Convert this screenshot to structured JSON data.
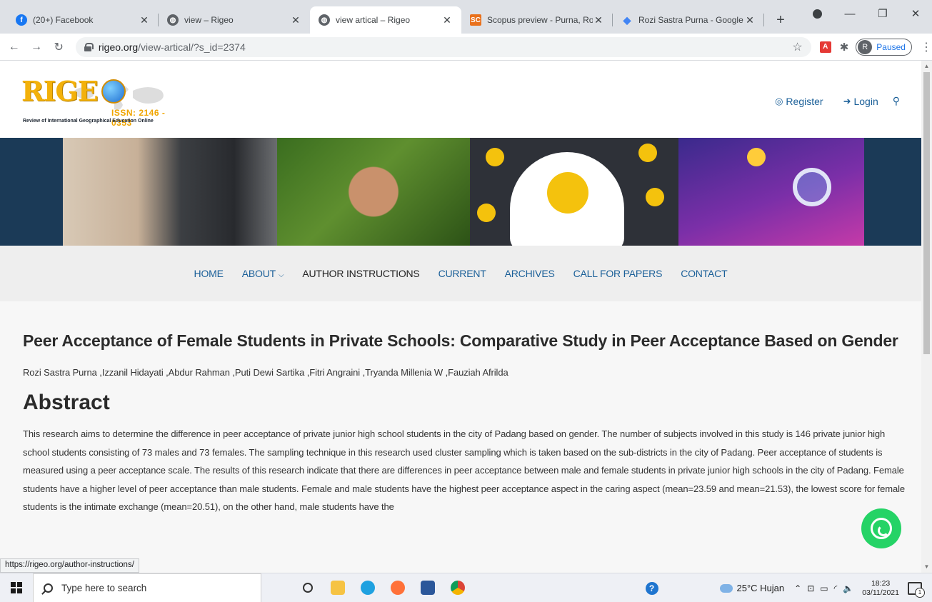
{
  "browser": {
    "tabs": [
      {
        "title": "(20+) Facebook",
        "icon": "facebook-icon",
        "color": "#1877f2"
      },
      {
        "title": "view – Rigeo",
        "icon": "globe-icon",
        "color": "#5f6368"
      },
      {
        "title": "view artical – Rigeo",
        "icon": "globe-icon",
        "color": "#5f6368",
        "active": true
      },
      {
        "title": "Scopus preview - Purna, Rozi",
        "icon": "scopus-icon",
        "color": "#e9711c",
        "icon_text": "SC"
      },
      {
        "title": "Rozi Sastra Purna - Google Scholar",
        "icon": "scholar-icon",
        "color": "#4285f4"
      }
    ],
    "new_tab": "+",
    "url_host": "rigeo.org",
    "url_path": "/view-artical/?s_id=2374",
    "profile_initial": "R",
    "profile_status": "Paused",
    "pdf_text": "A"
  },
  "site": {
    "logo_text": "RIGE",
    "issn": "ISSN: 2146 - 0353",
    "tagline": "Review of International Geographical Education Online",
    "register": "Register",
    "login": "Login",
    "accent": "#1a5f98",
    "nav": [
      {
        "label": "HOME",
        "style": "link"
      },
      {
        "label": "ABOUT",
        "style": "link",
        "dropdown": true
      },
      {
        "label": "AUTHOR INSTRUCTIONS",
        "style": "dark"
      },
      {
        "label": "CURRENT",
        "style": "link"
      },
      {
        "label": "ARCHIVES",
        "style": "link"
      },
      {
        "label": "CALL FOR PAPERS",
        "style": "link"
      },
      {
        "label": "CONTACT",
        "style": "link"
      }
    ]
  },
  "article": {
    "title": "Peer Acceptance of Female Students in Private Schools: Comparative Study in Peer Acceptance Based on Gender",
    "authors": "Rozi Sastra Purna ,Izzanil Hidayati ,Abdur Rahman ,Puti Dewi Sartika ,Fitri Angraini ,Tryanda Millenia W ,Fauziah Afrilda",
    "abstract_heading": "Abstract",
    "abstract": "This research aims to determine the difference in peer acceptance of private junior high school students in the city of Padang based on gender. The number of subjects involved in this study is 146 private junior high school students consisting of 73 males and 73 females. The sampling technique in this research used cluster sampling which is taken based on the sub-districts in the city of Padang. Peer acceptance of students is measured using a peer acceptance scale. The results of this research indicate that there are differences in peer acceptance between male and female students in private junior high schools in the city of Padang. Female students have a higher level of peer acceptance than male students. Female and male students have the highest peer acceptance aspect in the caring aspect (mean=23.59 and mean=21.53), the lowest score for female students is the intimate exchange (mean=20.51), on the other hand, male students have the"
  },
  "status_url": "https://rigeo.org/author-instructions/",
  "taskbar": {
    "search_placeholder": "Type here to search",
    "weather": "25°C  Hujan",
    "time": "18:23",
    "date": "03/11/2021",
    "help_text": "?",
    "apps": [
      {
        "name": "taskview-icon",
        "color": "#333333"
      },
      {
        "name": "file-explorer-icon",
        "color": "#f6c343"
      },
      {
        "name": "edge-icon",
        "color": "#1fa1e0"
      },
      {
        "name": "firefox-icon",
        "color": "#ff7139"
      },
      {
        "name": "word-icon",
        "color": "#2b579a"
      },
      {
        "name": "chrome-icon",
        "color": "#db4437"
      }
    ]
  }
}
